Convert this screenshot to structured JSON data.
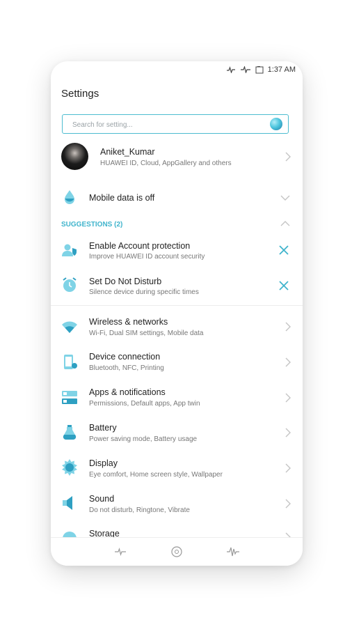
{
  "status_bar": {
    "time": "1:37 AM"
  },
  "header": {
    "title": "Settings"
  },
  "search": {
    "placeholder": "Search for setting..."
  },
  "account": {
    "name": "Aniket_Kumar",
    "subtitle": "HUAWEI ID, Cloud, AppGallery and others"
  },
  "mobile_data": {
    "label": "Mobile data is off"
  },
  "suggestions": {
    "header": "SUGGESTIONS (2)",
    "items": [
      {
        "title": "Enable Account protection",
        "subtitle": "Improve HUAWEI ID account security"
      },
      {
        "title": "Set Do Not Disturb",
        "subtitle": "Silence device during specific times"
      }
    ]
  },
  "settings": [
    {
      "title": "Wireless & networks",
      "subtitle": "Wi-Fi, Dual SIM settings, Mobile data",
      "icon": "wifi-icon"
    },
    {
      "title": "Device connection",
      "subtitle": "Bluetooth, NFC, Printing",
      "icon": "device-connection-icon"
    },
    {
      "title": "Apps & notifications",
      "subtitle": "Permissions, Default apps, App twin",
      "icon": "apps-icon"
    },
    {
      "title": "Battery",
      "subtitle": "Power saving mode, Battery usage",
      "icon": "battery-icon"
    },
    {
      "title": "Display",
      "subtitle": "Eye comfort, Home screen style, Wallpaper",
      "icon": "display-icon"
    },
    {
      "title": "Sound",
      "subtitle": "Do not disturb, Ringtone, Vibrate",
      "icon": "sound-icon"
    },
    {
      "title": "Storage",
      "subtitle": "",
      "icon": "storage-icon"
    }
  ],
  "colors": {
    "accent": "#3fb4cc",
    "icon_light": "#7fd3e6",
    "icon_dark": "#2ea0c2"
  }
}
